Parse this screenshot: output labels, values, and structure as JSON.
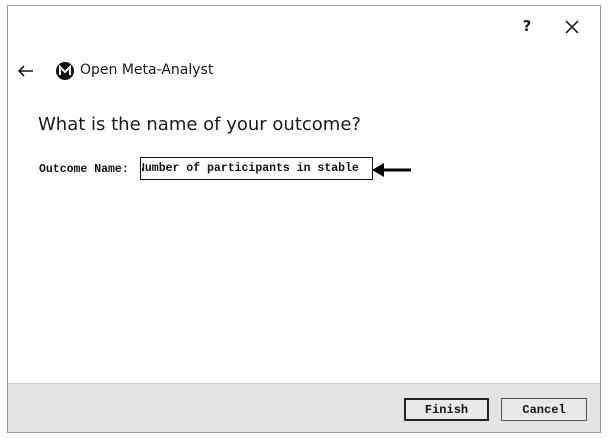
{
  "title_bar": {
    "help_label": "?",
    "close_icon": "close-icon"
  },
  "header": {
    "back_icon": "back-arrow-icon",
    "logo_icon": "meta-analyst-logo-icon",
    "title": "Open Meta-Analyst"
  },
  "main": {
    "question": "What is the name of your outcome?",
    "outcome_field": {
      "label": "Outcome Name:",
      "value": "Number of participants in stable",
      "placeholder": ""
    },
    "annotation_icon": "pointer-arrow-icon"
  },
  "footer": {
    "finish_label": "Finish",
    "cancel_label": "Cancel"
  },
  "colors": {
    "footer_bg": "#e4e4e4",
    "border": "#9a9a9a",
    "text": "#1a1a1a"
  }
}
